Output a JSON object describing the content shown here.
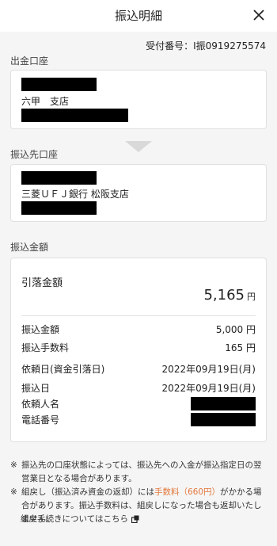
{
  "header": {
    "title": "振込明細"
  },
  "receipt": {
    "label": "受付番号：",
    "number": "I振0919275574"
  },
  "source": {
    "label": "出金口座",
    "branch": "六甲　支店"
  },
  "destination": {
    "label": "振込先口座",
    "bank": "三菱ＵＦＪ銀行 松阪支店"
  },
  "amount_section": {
    "label": "振込金額",
    "debit_label": "引落金額",
    "debit_value": "5,165",
    "debit_unit": "円",
    "rows": [
      {
        "label": "振込金額",
        "value": "5,000 円"
      },
      {
        "label": "振込手数料",
        "value": "165 円"
      },
      {
        "label": "依頼日(資金引落日)",
        "value": "2022年09月19日(月)"
      },
      {
        "label": "振込日",
        "value": "2022年09月19日(月)"
      },
      {
        "label": "依頼人名",
        "value": ""
      },
      {
        "label": "電話番号",
        "value": ""
      }
    ]
  },
  "notes": {
    "mark": "※",
    "note1": "振込先の口座状態によっては、振込先への入金が振込指定日の翌営業日となる場合があります。",
    "note2_pre": "組戻し（振込済み資金の返却）には",
    "note2_fee": "手数料（660円）",
    "note2_post": "がかかる場合があります。振込手数料は、組戻しになった場合も返却いたしません。",
    "link": "組戻手続きについてはこちら"
  }
}
